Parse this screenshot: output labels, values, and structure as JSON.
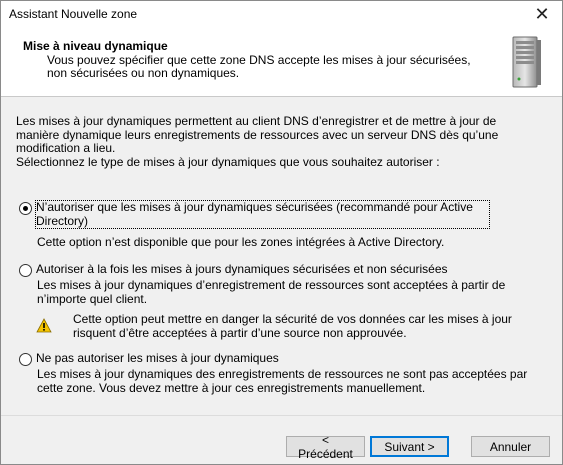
{
  "window": {
    "title": "Assistant Nouvelle zone"
  },
  "header": {
    "title": "Mise à niveau dynamique",
    "description": "Vous pouvez spécifier que cette zone DNS accepte les mises à jour sécurisées, non sécurisées ou non dynamiques."
  },
  "intro": {
    "paragraph": "Les mises à jour dynamiques permettent au client DNS d’enregistrer et de mettre à jour de manière dynamique leurs enregistrements de ressources avec un serveur DNS dès qu’une modification a lieu.",
    "prompt": "Sélectionnez le type de mises à jour dynamiques que vous souhaitez autoriser :"
  },
  "options": [
    {
      "label": "N’autoriser que les mises à jour dynamiques sécurisées (recommandé pour Active Directory)",
      "description": "Cette option n’est disponible que pour les zones intégrées à Active Directory.",
      "selected": true
    },
    {
      "label": "Autoriser à la fois les mises à jours dynamiques sécurisées et non sécurisées",
      "description": "Les mises à jour dynamiques d’enregistrement de ressources sont acceptées à partir de n’importe quel client.",
      "warning": "Cette option peut mettre en danger la sécurité de vos données car les mises à jour risquent d’être acceptées à partir d’une source non approuvée.",
      "selected": false
    },
    {
      "label": "Ne pas autoriser les mises à jour dynamiques",
      "description": "Les mises à jour dynamiques des enregistrements de ressources ne sont pas acceptées par cette zone. Vous devez mettre à jour ces enregistrements manuellement.",
      "selected": false
    }
  ],
  "buttons": {
    "back": "< Précédent",
    "next": "Suivant >",
    "cancel": "Annuler"
  },
  "icons": {
    "close": "close-icon",
    "server": "server-icon",
    "warning": "warning-icon"
  },
  "colors": {
    "accent": "#0078d7",
    "warning": "#f5c400"
  }
}
